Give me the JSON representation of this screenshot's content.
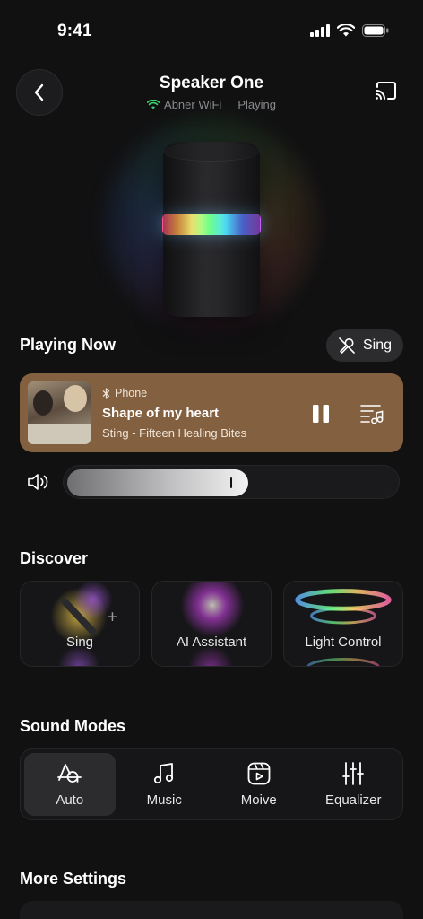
{
  "status": {
    "time": "9:41"
  },
  "header": {
    "title": "Speaker One",
    "network": "Abner WiFi",
    "state": "Playing"
  },
  "playing_now": {
    "section_title": "Playing Now",
    "sing_label": "Sing",
    "source": "Phone",
    "song": "Shape of my heart",
    "artist": "Sting - Fifteen Healing Bites",
    "volume_fraction": 0.55
  },
  "discover": {
    "section_title": "Discover",
    "items": [
      {
        "label": "Sing"
      },
      {
        "label": "AI Assistant"
      },
      {
        "label": "Light Control"
      }
    ]
  },
  "sound_modes": {
    "section_title": "Sound Modes",
    "items": [
      {
        "label": "Auto",
        "active": true
      },
      {
        "label": "Music",
        "active": false
      },
      {
        "label": "Moive",
        "active": false
      },
      {
        "label": "Equalizer",
        "active": false
      }
    ]
  },
  "more_settings": {
    "section_title": "More Settings"
  },
  "colors": {
    "background": "#111112",
    "now_playing_card": "#83603f",
    "wifi_indicator": "#3cd26a"
  }
}
